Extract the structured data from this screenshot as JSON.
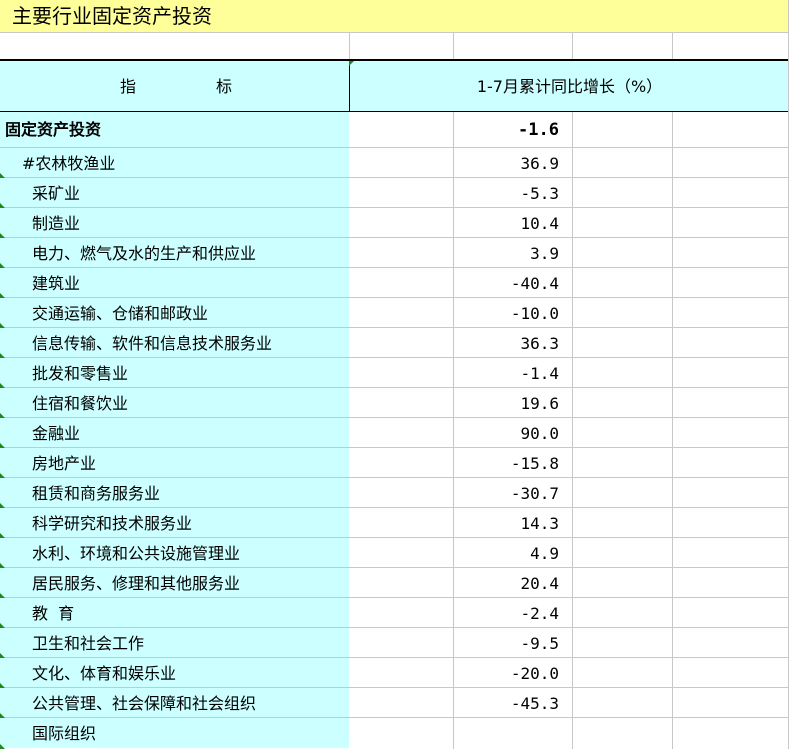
{
  "title": "主要行业固定资产投资",
  "header": {
    "indicator_part1": "指",
    "indicator_part2": "标",
    "growth": "1-7月累计同比增长（%）"
  },
  "rows": [
    {
      "name": "固定资产投资",
      "value": "-1.6"
    },
    {
      "name": "#农林牧渔业",
      "value": "36.9"
    },
    {
      "name": "采矿业",
      "value": "-5.3"
    },
    {
      "name": "制造业",
      "value": "10.4"
    },
    {
      "name": "电力、燃气及水的生产和供应业",
      "value": "3.9"
    },
    {
      "name": "建筑业",
      "value": "-40.4"
    },
    {
      "name": "交通运输、仓储和邮政业",
      "value": "-10.0"
    },
    {
      "name": "信息传输、软件和信息技术服务业",
      "value": "36.3"
    },
    {
      "name": "批发和零售业",
      "value": "-1.4"
    },
    {
      "name": "住宿和餐饮业",
      "value": "19.6"
    },
    {
      "name": "金融业",
      "value": "90.0"
    },
    {
      "name": "房地产业",
      "value": "-15.8"
    },
    {
      "name": "租赁和商务服务业",
      "value": "-30.7"
    },
    {
      "name": "科学研究和技术服务业",
      "value": "14.3"
    },
    {
      "name": "水利、环境和公共设施管理业",
      "value": "4.9"
    },
    {
      "name": "居民服务、修理和其他服务业",
      "value": "20.4"
    },
    {
      "name": "教  育",
      "value": "-2.4"
    },
    {
      "name": "卫生和社会工作",
      "value": "-9.5"
    },
    {
      "name": "文化、体育和娱乐业",
      "value": "-20.0"
    },
    {
      "name": "公共管理、社会保障和社会组织",
      "value": "-45.3"
    },
    {
      "name": "国际组织",
      "value": ""
    }
  ],
  "colors": {
    "title_bg": "#ffff99",
    "label_bg": "#ccffff",
    "grid": "#c8c8c8",
    "marker": "#1e8a1e"
  }
}
